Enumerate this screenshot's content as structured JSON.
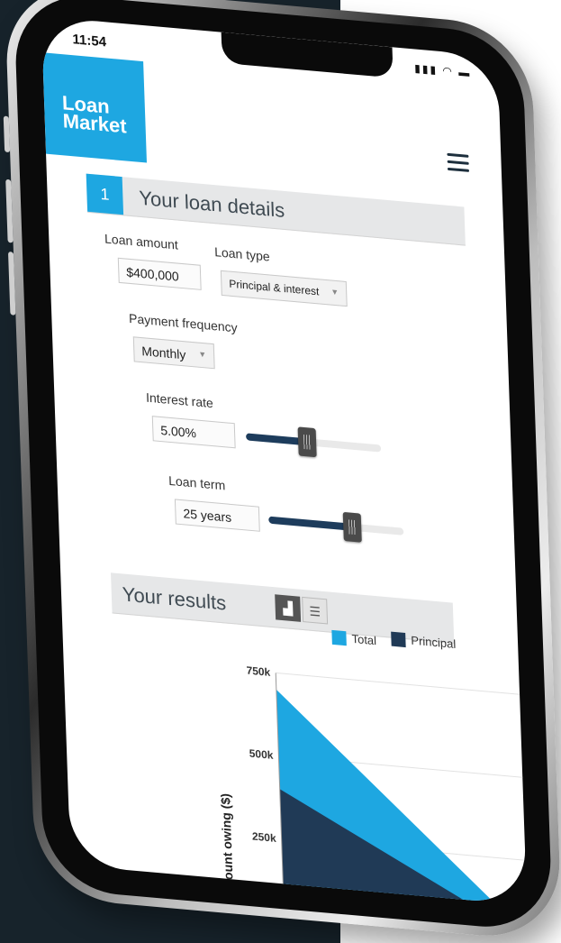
{
  "status": {
    "time": "11:54",
    "icons": "signal wifi battery"
  },
  "logo": {
    "line1": "Loan",
    "line2": "Market"
  },
  "header": {
    "menu_icon": "hamburger-menu-icon"
  },
  "section1": {
    "step": "1",
    "title": "Your loan details"
  },
  "form": {
    "loan_amount": {
      "label": "Loan amount",
      "value": "$400,000"
    },
    "loan_type": {
      "label": "Loan type",
      "value": "Principal & interest"
    },
    "payment_frequency": {
      "label": "Payment frequency",
      "value": "Monthly"
    },
    "interest_rate": {
      "label": "Interest rate",
      "value": "5.00%",
      "slider_fraction": 0.45
    },
    "loan_term": {
      "label": "Loan term",
      "value": "25 years",
      "slider_fraction": 0.62
    }
  },
  "results": {
    "title": "Your results",
    "chart_view_icon": "bar-chart-icon",
    "list_view_icon": "list-icon"
  },
  "colors": {
    "accent": "#1ea7e1",
    "navy": "#1d3c5c",
    "total": "#1ea7e1",
    "principal": "#203a56"
  },
  "chart_data": {
    "type": "area",
    "ylabel": "Amount owing ($)",
    "ylim": [
      0,
      750000
    ],
    "yticks": [
      "250k",
      "500k",
      "750k"
    ],
    "ytick_values": [
      250000,
      500000,
      750000
    ],
    "legend": [
      "Total",
      "Principal"
    ],
    "series": [
      {
        "name": "Total",
        "x": [
          0,
          25
        ],
        "values": [
          700000,
          0
        ]
      },
      {
        "name": "Principal",
        "x": [
          0,
          25
        ],
        "values": [
          400000,
          0
        ]
      }
    ]
  }
}
